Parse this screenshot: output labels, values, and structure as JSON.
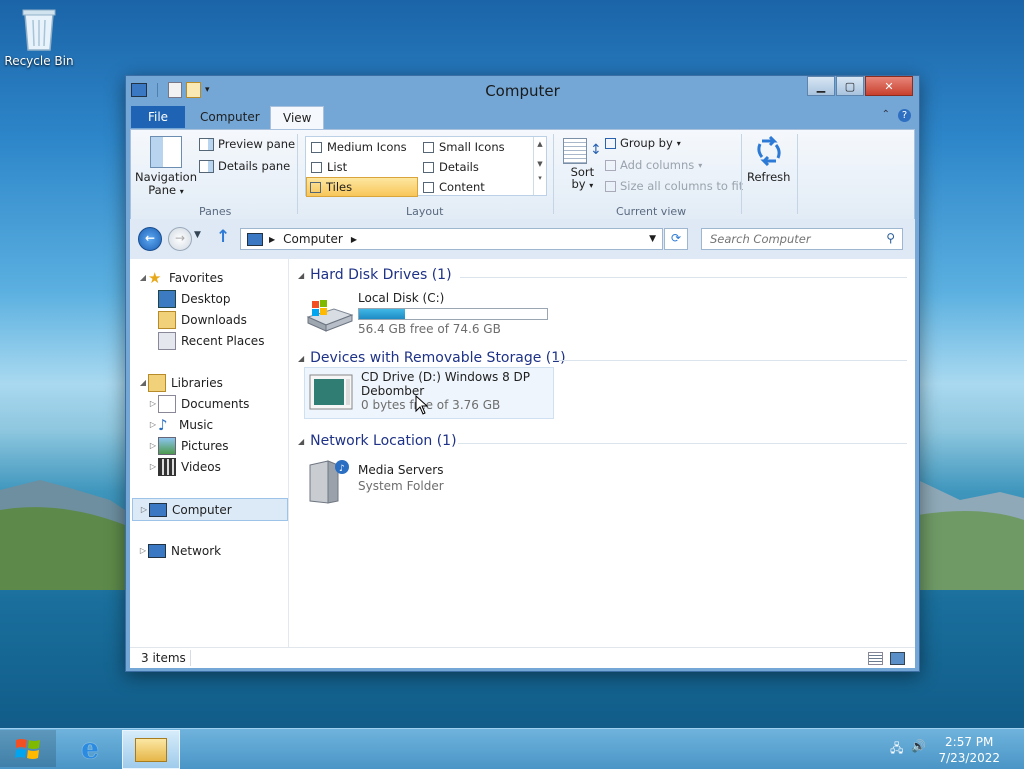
{
  "desktop": {
    "recycle_bin_label": "Recycle Bin"
  },
  "window": {
    "title": "Computer",
    "tabs": {
      "file": "File",
      "computer": "Computer",
      "view": "View"
    },
    "ribbon": {
      "panes": {
        "navigation_pane": "Navigation",
        "navigation_pane_2": "Pane",
        "preview_pane": "Preview pane",
        "details_pane": "Details pane",
        "group_label": "Panes"
      },
      "layout": {
        "medium_icons": "Medium Icons",
        "small_icons": "Small Icons",
        "list": "List",
        "details": "Details",
        "tiles": "Tiles",
        "content": "Content",
        "group_label": "Layout"
      },
      "current_view": {
        "sort_by": "Sort",
        "sort_by_2": "by",
        "group_by": "Group by",
        "add_columns": "Add columns",
        "size_columns": "Size all columns to fit",
        "group_label": "Current view"
      },
      "refresh": "Refresh"
    },
    "address": {
      "path": "Computer"
    },
    "search": {
      "placeholder": "Search Computer"
    },
    "nav": {
      "favorites": "Favorites",
      "desktop": "Desktop",
      "downloads": "Downloads",
      "recent_places": "Recent Places",
      "libraries": "Libraries",
      "documents": "Documents",
      "music": "Music",
      "pictures": "Pictures",
      "videos": "Videos",
      "computer": "Computer",
      "network": "Network"
    },
    "groups": {
      "hard_disk": {
        "title": "Hard Disk Drives (1)",
        "item_name": "Local Disk (C:)",
        "item_sub": "56.4 GB free of 74.6 GB",
        "used_fraction": 0.244
      },
      "removable": {
        "title": "Devices with Removable Storage (1)",
        "item_name": "CD Drive (D:) Windows 8 DP",
        "item_name_2": "Debomber",
        "item_sub": "0 bytes free of 3.76 GB"
      },
      "network": {
        "title": "Network Location (1)",
        "item_name": "Media Servers",
        "item_sub": "System Folder"
      }
    },
    "status": {
      "items_count": "3 items"
    }
  },
  "taskbar": {
    "time": "2:57 PM",
    "date": "7/23/2022"
  }
}
